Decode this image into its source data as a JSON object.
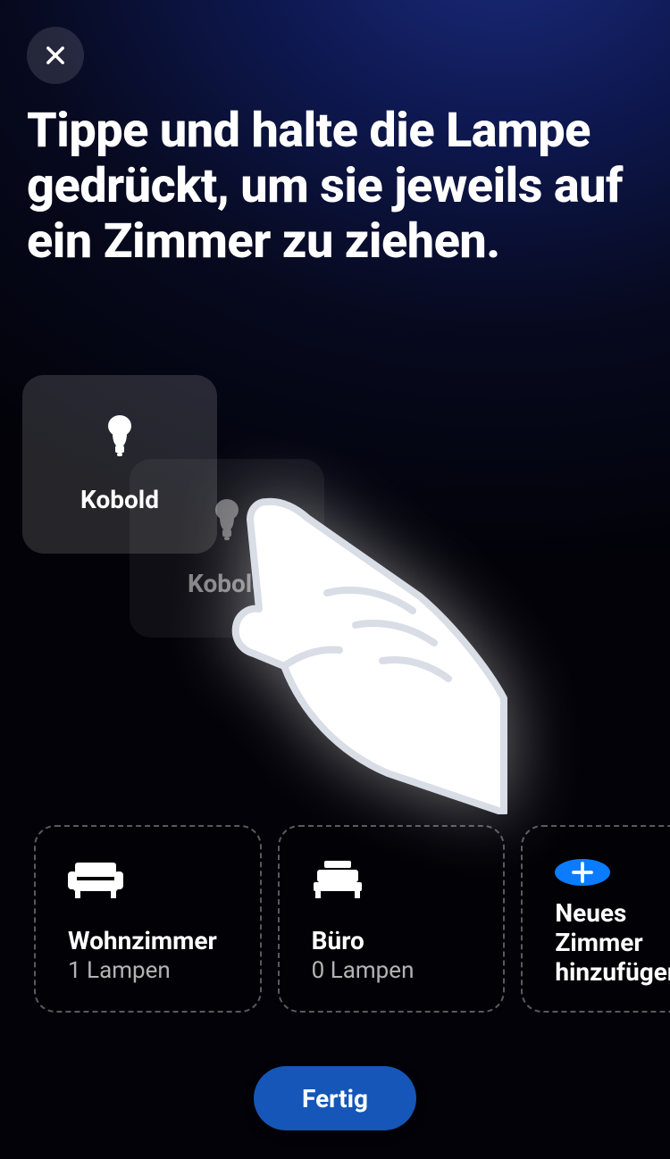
{
  "header": {
    "close_label": "Schließen",
    "title": "Tippe und halte die Lampe gedrückt, um sie jeweils auf ein Zimmer zu ziehen."
  },
  "lamp": {
    "name": "Kobold",
    "ghost_name": "Kobold"
  },
  "rooms": [
    {
      "title": "Wohnzimmer",
      "subtitle": "1 Lampen",
      "icon": "sofa"
    },
    {
      "title": "Büro",
      "subtitle": "0 Lampen",
      "icon": "bed"
    }
  ],
  "add_room": {
    "title": "Neues Zimmer hinzufügen"
  },
  "done_label": "Fertig"
}
